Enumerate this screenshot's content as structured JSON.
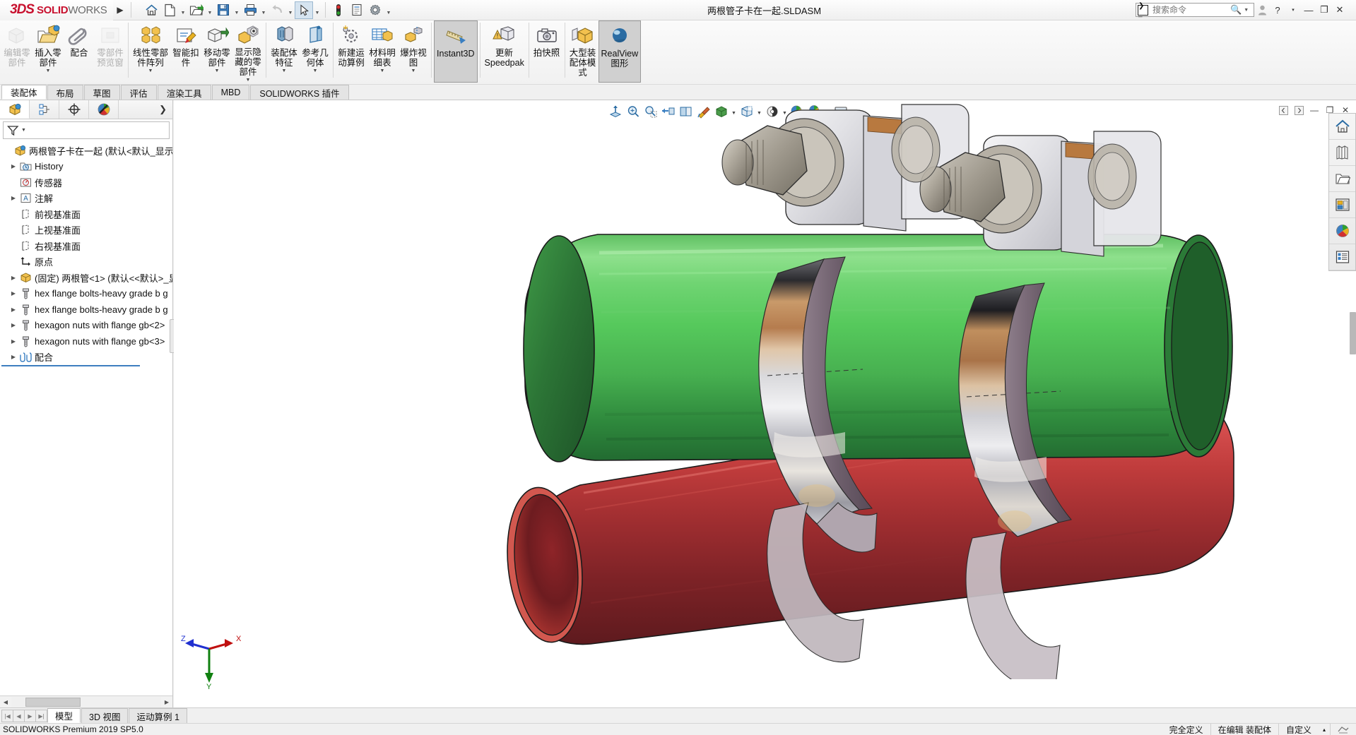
{
  "app": {
    "brand_3ds": "3DS",
    "brand_name": "SOLIDWORKS",
    "brand_name_bold": "SOLID",
    "brand_name_light": "WORKS",
    "document_title": "两根管子卡在一起.SLDASM"
  },
  "quick_access": {
    "items": [
      {
        "name": "home-icon",
        "label": "主页",
        "dropdown": false
      },
      {
        "name": "new-document-icon",
        "label": "新建",
        "dropdown": true
      },
      {
        "name": "open-folder-icon",
        "label": "打开",
        "dropdown": true
      },
      {
        "name": "save-icon",
        "label": "保存",
        "dropdown": true
      },
      {
        "name": "print-icon",
        "label": "打印",
        "dropdown": true
      },
      {
        "name": "undo-icon",
        "label": "撤销",
        "dropdown": true
      },
      {
        "name": "select-cursor-icon",
        "label": "选择",
        "dropdown": true
      },
      {
        "name": "rebuild-icon",
        "label": "重建模型",
        "dropdown": false
      },
      {
        "name": "file-properties-icon",
        "label": "文件属性",
        "dropdown": false
      },
      {
        "name": "options-gear-icon",
        "label": "选项",
        "dropdown": true
      }
    ]
  },
  "search": {
    "placeholder": "搜索命令",
    "value": ""
  },
  "window_controls": {
    "user": "用户",
    "help": "?",
    "help_caret": "▾",
    "minimize": "—",
    "restore": "❐",
    "close": "✕"
  },
  "ribbon": {
    "items": [
      {
        "label": "编辑零\n部件",
        "icon": "edit-component-icon",
        "disabled": true,
        "caret": false,
        "active": false
      },
      {
        "label": "插入零\n部件",
        "icon": "insert-component-icon",
        "disabled": false,
        "caret": true,
        "active": false
      },
      {
        "label": "配合",
        "icon": "mate-paperclip-icon",
        "disabled": false,
        "caret": false,
        "active": false
      },
      {
        "label": "零部件\n预览窗",
        "icon": "component-preview-icon",
        "disabled": true,
        "caret": false,
        "active": false
      },
      {
        "label": "线性零部\n件阵列",
        "icon": "linear-component-pattern-icon",
        "disabled": false,
        "caret": true,
        "active": false
      },
      {
        "label": "智能扣\n件",
        "icon": "smart-fasteners-icon",
        "disabled": false,
        "caret": false,
        "active": false
      },
      {
        "label": "移动零\n部件",
        "icon": "move-component-icon",
        "disabled": false,
        "caret": true,
        "active": false
      },
      {
        "label": "显示隐\n藏的零\n部件",
        "icon": "show-hidden-components-icon",
        "disabled": false,
        "caret": true,
        "active": false
      },
      {
        "label": "装配体\n特征",
        "icon": "assembly-features-icon",
        "disabled": false,
        "caret": true,
        "active": false
      },
      {
        "label": "参考几\n何体",
        "icon": "reference-geometry-icon",
        "disabled": false,
        "caret": true,
        "active": false
      },
      {
        "label": "新建运\n动算例",
        "icon": "new-motion-study-icon",
        "disabled": false,
        "caret": false,
        "active": false
      },
      {
        "label": "材料明\n细表",
        "icon": "bill-of-materials-icon",
        "disabled": false,
        "caret": true,
        "active": false
      },
      {
        "label": "爆炸视\n图",
        "icon": "exploded-view-icon",
        "disabled": false,
        "caret": true,
        "active": false
      },
      {
        "label": "Instant3D",
        "icon": "instant3d-icon",
        "disabled": false,
        "caret": false,
        "active": true
      },
      {
        "label": "更新\nSpeedpak",
        "icon": "update-speedpak-icon",
        "disabled": false,
        "caret": false,
        "active": false
      },
      {
        "label": "拍快照",
        "icon": "snapshot-camera-icon",
        "disabled": false,
        "caret": false,
        "active": false
      },
      {
        "label": "大型装\n配体模\n式",
        "icon": "large-assembly-mode-icon",
        "disabled": false,
        "caret": false,
        "active": false
      },
      {
        "label": "RealView\n图形",
        "icon": "realview-graphics-icon",
        "disabled": false,
        "caret": false,
        "active": true
      }
    ]
  },
  "tabs": {
    "items": [
      {
        "label": "装配体",
        "active": true
      },
      {
        "label": "布局",
        "active": false
      },
      {
        "label": "草图",
        "active": false
      },
      {
        "label": "评估",
        "active": false
      },
      {
        "label": "渲染工具",
        "active": false
      },
      {
        "label": "MBD",
        "active": false
      },
      {
        "label": "SOLIDWORKS 插件",
        "active": false
      }
    ]
  },
  "left_panel": {
    "tabs": [
      {
        "name": "feature-manager-tab",
        "active": true
      },
      {
        "name": "property-manager-tab",
        "active": false
      },
      {
        "name": "configuration-manager-tab",
        "active": false
      },
      {
        "name": "display-manager-tab",
        "active": false
      }
    ],
    "expand_label": "❯",
    "filter_placeholder": "",
    "tree": [
      {
        "label": "两根管子卡在一起  (默认<默认_显示状态",
        "icon": "assembly-icon",
        "indent": 0,
        "twisty": false,
        "level": 0
      },
      {
        "label": "History",
        "icon": "history-icon",
        "indent": 1,
        "twisty": true,
        "level": 1
      },
      {
        "label": "传感器",
        "icon": "sensors-icon",
        "indent": 1,
        "twisty": false,
        "level": 1
      },
      {
        "label": "注解",
        "icon": "annotations-icon",
        "indent": 1,
        "twisty": true,
        "level": 1
      },
      {
        "label": "前视基准面",
        "icon": "plane-icon",
        "indent": 1,
        "twisty": false,
        "level": 1
      },
      {
        "label": "上视基准面",
        "icon": "plane-icon",
        "indent": 1,
        "twisty": false,
        "level": 1
      },
      {
        "label": "右视基准面",
        "icon": "plane-icon",
        "indent": 1,
        "twisty": false,
        "level": 1
      },
      {
        "label": "原点",
        "icon": "origin-icon",
        "indent": 1,
        "twisty": false,
        "level": 1
      },
      {
        "label": "(固定) 两根管<1> (默认<<默认>_显",
        "icon": "part-icon",
        "indent": 1,
        "twisty": true,
        "level": 1
      },
      {
        "label": "hex flange bolts-heavy grade b g",
        "icon": "bolt-icon",
        "indent": 1,
        "twisty": true,
        "level": 1
      },
      {
        "label": "hex flange bolts-heavy grade b g",
        "icon": "bolt-icon",
        "indent": 1,
        "twisty": true,
        "level": 1
      },
      {
        "label": "hexagon nuts with flange gb<2>",
        "icon": "nut-icon",
        "indent": 1,
        "twisty": true,
        "level": 1
      },
      {
        "label": "hexagon nuts with flange gb<3>",
        "icon": "nut-icon",
        "indent": 1,
        "twisty": true,
        "level": 1
      },
      {
        "label": "配合",
        "icon": "mates-folder-icon",
        "indent": 1,
        "twisty": true,
        "level": 1
      }
    ]
  },
  "heads_up_toolbar": {
    "items": [
      {
        "name": "zoom-to-fit-icon",
        "caret": false
      },
      {
        "name": "zoom-to-area-icon",
        "caret": false
      },
      {
        "name": "previous-view-icon",
        "caret": false
      },
      {
        "name": "section-view-icon",
        "caret": false
      },
      {
        "name": "view-orientation-icon",
        "caret": false
      },
      {
        "name": "appearance-paint-icon",
        "caret": false
      },
      {
        "name": "display-style-icon",
        "caret": true
      },
      {
        "name": "hide-show-items-icon",
        "caret": true
      },
      {
        "name": "edit-appearance-icon",
        "caret": false
      },
      {
        "name": "apply-scene-icon",
        "caret": true
      },
      {
        "name": "view-settings-icon",
        "caret": true
      }
    ]
  },
  "doc_window_controls": {
    "prev": "◀",
    "next": "▶",
    "minimize": "—",
    "restore": "❐",
    "close": "✕"
  },
  "task_pane": {
    "items": [
      {
        "name": "solidworks-resources-icon"
      },
      {
        "name": "design-library-icon"
      },
      {
        "name": "file-explorer-icon"
      },
      {
        "name": "view-palette-icon"
      },
      {
        "name": "appearances-scenes-icon"
      },
      {
        "name": "custom-properties-icon"
      }
    ]
  },
  "triad": {
    "x_label": "X",
    "y_label": "Y",
    "z_label": "Z"
  },
  "bottom_tabs": {
    "nav": [
      "|◀",
      "◀",
      "▶",
      "▶|"
    ],
    "items": [
      {
        "label": "模型",
        "active": true
      },
      {
        "label": "3D 视图",
        "active": false
      },
      {
        "label": "运动算例 1",
        "active": false
      }
    ]
  },
  "status_bar": {
    "version": "SOLIDWORKS Premium 2019 SP5.0",
    "state": "完全定义",
    "editing": "在编辑 装配体",
    "units": "自定义",
    "units_caret": "▴"
  },
  "model": {
    "green_pipe_color": "#53d05a",
    "green_pipe_dark": "#2f7a3c",
    "red_pipe_color": "#c03636",
    "red_pipe_dark": "#6d1c1f",
    "clamp_metal": "#c9c9cc",
    "copper": "#b97b4f",
    "bolt_color": "#a8a196",
    "description": "两根管子被两个管夹卡在一起的三维装配体"
  }
}
